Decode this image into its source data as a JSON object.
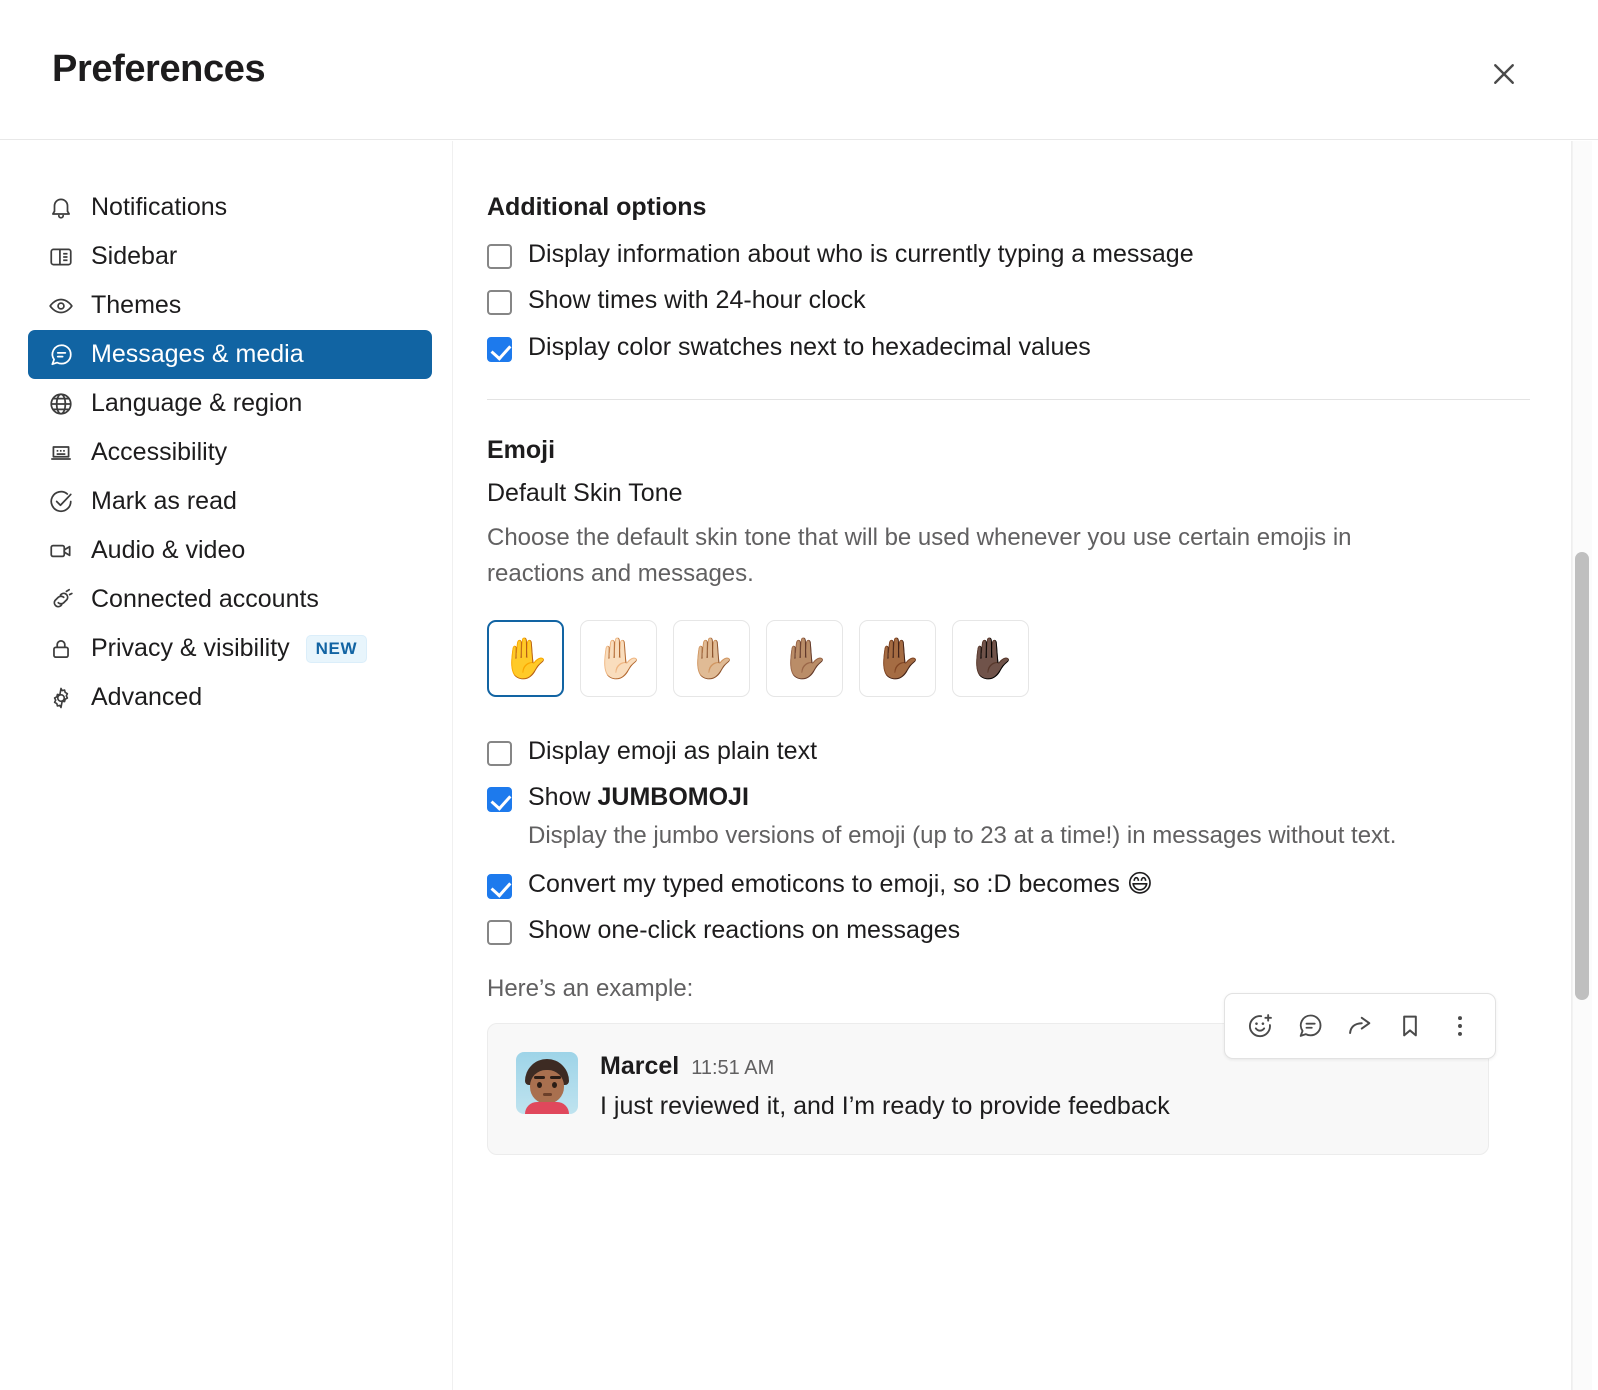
{
  "window": {
    "title": "Preferences",
    "close_icon": "close-icon"
  },
  "colors": {
    "accent_sidebar_active": "#1164a3",
    "checkbox_checked": "#1d7aed",
    "badge_bg": "#e8f5fc",
    "badge_text": "#1264a3",
    "selected_swatch_border": "#1264a3",
    "text_primary": "#1d1c1d",
    "text_muted": "#616061",
    "card_bg": "#f8f8f8"
  },
  "sidebar": {
    "items": [
      {
        "label": "Notifications",
        "icon": "bell-icon",
        "active": false
      },
      {
        "label": "Sidebar",
        "icon": "sidebar-panel-icon",
        "active": false
      },
      {
        "label": "Themes",
        "icon": "eye-icon",
        "active": false
      },
      {
        "label": "Messages & media",
        "icon": "message-bubble-icon",
        "active": true
      },
      {
        "label": "Language & region",
        "icon": "globe-icon",
        "active": false
      },
      {
        "label": "Accessibility",
        "icon": "laptop-icon",
        "active": false
      },
      {
        "label": "Mark as read",
        "icon": "check-circle-icon",
        "active": false
      },
      {
        "label": "Audio & video",
        "icon": "video-camera-icon",
        "active": false
      },
      {
        "label": "Connected accounts",
        "icon": "plug-icon",
        "active": false
      },
      {
        "label": "Privacy & visibility",
        "icon": "lock-icon",
        "active": false,
        "badge": "NEW"
      },
      {
        "label": "Advanced",
        "icon": "gear-icon",
        "active": false
      }
    ]
  },
  "main": {
    "additional_options": {
      "heading": "Additional options",
      "checkboxes": [
        {
          "label": "Display information about who is currently typing a message",
          "checked": false
        },
        {
          "label": "Show times with 24-hour clock",
          "checked": false
        },
        {
          "label": "Display color swatches next to hexadecimal values",
          "checked": true
        }
      ]
    },
    "emoji": {
      "heading": "Emoji",
      "skin_tone": {
        "subheading": "Default Skin Tone",
        "description": "Choose the default skin tone that will be used whenever you use certain emojis in reactions and messages.",
        "swatches": [
          {
            "glyph": "✋",
            "name": "skin-tone-default",
            "selected": true
          },
          {
            "glyph": "✋🏻",
            "name": "skin-tone-light",
            "selected": false
          },
          {
            "glyph": "✋🏼",
            "name": "skin-tone-medium-light",
            "selected": false
          },
          {
            "glyph": "✋🏽",
            "name": "skin-tone-medium",
            "selected": false
          },
          {
            "glyph": "✋🏾",
            "name": "skin-tone-medium-dark",
            "selected": false
          },
          {
            "glyph": "✋🏿",
            "name": "skin-tone-dark",
            "selected": false
          }
        ]
      },
      "checkboxes": [
        {
          "label": "Display emoji as plain text",
          "checked": false
        },
        {
          "label_prefix": "Show ",
          "label_bold": "JUMBOMOJI",
          "checked": true,
          "description": "Display the jumbo versions of emoji (up to 23 at a time!) in messages without text."
        },
        {
          "label": "Convert my typed emoticons to emoji, so :D becomes ",
          "trailing_emoji": "😄",
          "checked": true
        },
        {
          "label": "Show one-click reactions on messages",
          "checked": false
        }
      ]
    },
    "example": {
      "note": "Here’s an example:",
      "message": {
        "author": "Marcel",
        "time": "11:51 AM",
        "text": "I just reviewed it, and I’m ready to provide feedback",
        "avatar": "avatar"
      },
      "hover_toolbar": [
        {
          "name": "add-reaction-icon",
          "label": "Add reaction"
        },
        {
          "name": "reply-in-thread-icon",
          "label": "Reply in thread"
        },
        {
          "name": "forward-message-icon",
          "label": "Forward message"
        },
        {
          "name": "save-message-icon",
          "label": "Save for later"
        },
        {
          "name": "more-actions-icon",
          "label": "More actions"
        }
      ]
    }
  },
  "scroll": {
    "thumb_name": "vertical-scrollbar-thumb"
  }
}
